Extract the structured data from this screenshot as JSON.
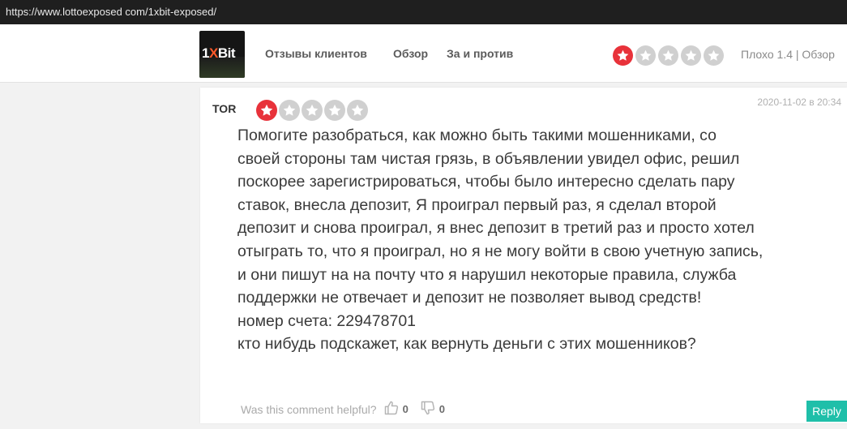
{
  "browser": {
    "url": "https://www.lottoexposed com/1xbit-exposed/"
  },
  "header": {
    "logo_text": {
      "prefix": "1",
      "x": "X",
      "suffix": "Bit"
    },
    "nav": [
      "Отзывы клиентов",
      "Обзор",
      "За и против"
    ],
    "rating": {
      "stars_filled": 1,
      "stars_total": 5,
      "text": "Плохо 1.4 | Обзор"
    }
  },
  "review": {
    "author": "TOR",
    "stars_filled": 1,
    "stars_total": 5,
    "date": "2020-11-02 в 20:34",
    "lines": [
      "Помогите разобраться, как можно быть такими мошенниками, со",
      "своей стороны там чистая грязь, в объявлении увидел офис, решил",
      "поскорее зарегистрироваться, чтобы было интересно сделать пару",
      "ставок, внесла депозит, Я проиграл первый раз, я сделал второй",
      "депозит и снова проиграл, я внес депозит в третий раз и просто хотел",
      "отыграть то, что я проиграл, но я не могу войти в свою учетную запись,",
      "и они пишут на на почту что я нарушил некоторые правила, служба",
      "поддержки не отвечает и депозит не позволяет вывод средств!",
      "номер счета: 229478701",
      "кто нибудь подскажет, как вернуть деньги с этих мошенников?"
    ],
    "helpful_label": "Was this comment helpful?",
    "likes": "0",
    "dislikes": "0",
    "reply_label": "Reply"
  },
  "colors": {
    "accent_red": "#e8323a",
    "reply_teal": "#1fbfa9",
    "star_off": "#d0d0d0"
  },
  "icons": [
    "star-icon",
    "thumbs-up-icon",
    "thumbs-down-icon"
  ]
}
